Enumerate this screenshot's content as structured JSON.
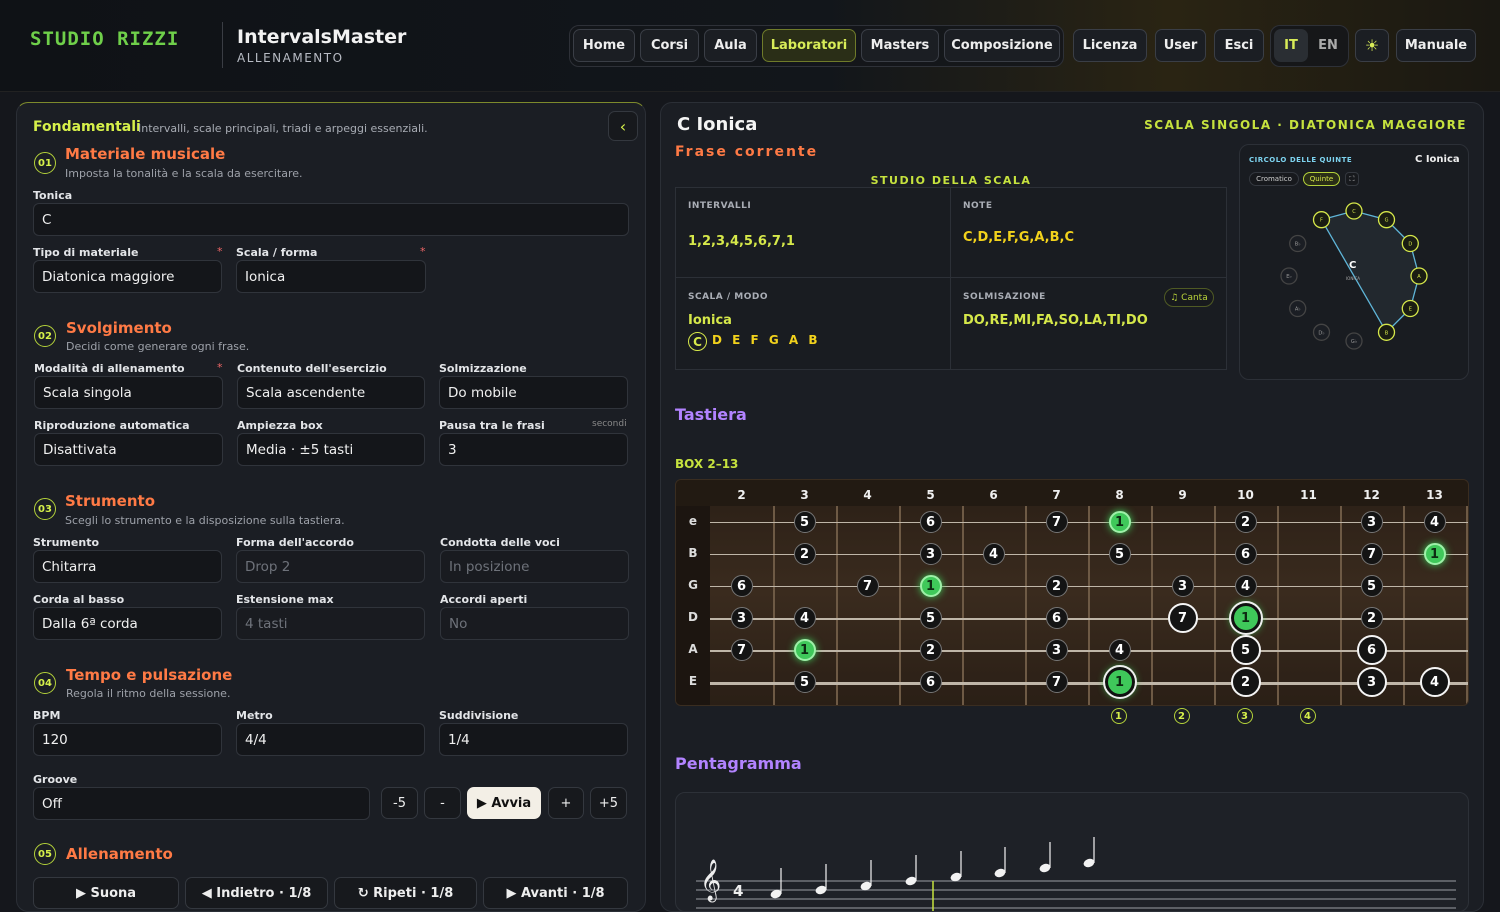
{
  "header": {
    "logo": "STUDIO RIZZI",
    "app_title": "IntervalsMaster",
    "app_subtitle": "ALLENAMENTO",
    "nav": [
      "Home",
      "Corsi",
      "Aula",
      "Laboratori",
      "Masters",
      "Composizione"
    ],
    "nav_active": "Laboratori",
    "nav2": [
      "Licenza",
      "User",
      "Esci"
    ],
    "lang": [
      "IT",
      "EN"
    ],
    "theme_icon": "sun-icon",
    "manual": "Manuale",
    "accent": "#d8ec58"
  },
  "left": {
    "title": "Fondamentali",
    "subtitle": "Intervalli, scale principali, triadi e arpeggi essenziali.",
    "collapse": "‹",
    "s1": {
      "num": "01",
      "title": "Materiale musicale",
      "sub": "Imposta la tonalità e la scala da esercitare.",
      "tonica_label": "Tonica",
      "tonica": "C",
      "tipo_label": "Tipo di materiale",
      "tipo": "Diatonica maggiore",
      "scala_label": "Scala / forma",
      "scala": "Ionica",
      "req": "*"
    },
    "s2": {
      "num": "02",
      "title": "Svolgimento",
      "sub": "Decidi come generare ogni frase.",
      "mod_label": "Modalità di allenamento",
      "mod": "Scala singola",
      "cont_label": "Contenuto dell'esercizio",
      "cont": "Scala ascendente",
      "solm_label": "Solmizzazione",
      "solm": "Do mobile",
      "rip_label": "Riproduzione automatica",
      "rip": "Disattivata",
      "amp_label": "Ampiezza box",
      "amp": "Media · ±5 tasti",
      "pausa_label": "Pausa tra le frasi",
      "pausa_unit": "secondi",
      "pausa": "3"
    },
    "s3": {
      "num": "03",
      "title": "Strumento",
      "sub": "Scegli lo strumento e la disposizione sulla tastiera.",
      "str_label": "Strumento",
      "str": "Chitarra",
      "forma_label": "Forma dell'accordo",
      "forma": "Drop 2",
      "cond_label": "Condotta delle voci",
      "cond": "In posizione",
      "corda_label": "Corda al basso",
      "corda": "Dalla 6ª corda",
      "est_label": "Estensione max",
      "est": "4 tasti",
      "acc_label": "Accordi aperti",
      "acc": "No"
    },
    "s4": {
      "num": "04",
      "title": "Tempo e pulsazione",
      "sub": "Regola il ritmo della sessione.",
      "bpm_label": "BPM",
      "bpm": "120",
      "metro_label": "Metro",
      "metro": "4/4",
      "sudd_label": "Suddivisione",
      "sudd": "1/4",
      "groove_label": "Groove",
      "groove": "Off",
      "m5": "-5",
      "minus": "-",
      "start": "▶ Avvia",
      "plus": "+",
      "p5": "+5"
    },
    "s5": {
      "num": "05",
      "title": "Allenamento",
      "play": "▶ Suona",
      "back": "◀ Indietro · 1/8",
      "repeat": "↻ Ripeti · 1/8",
      "fwd": "▶ Avanti · 1/8"
    }
  },
  "right": {
    "title": "C Ionica",
    "tag": "SCALA SINGOLA · DIATONICA MAGGIORE",
    "phrase": "Frase corrente",
    "study": "STUDIO DELLA SCALA",
    "int_cap": "INTERVALLI",
    "intervals": "1,2,3,4,5,6,7,1",
    "note_cap": "NOTE",
    "notes": "C,D,E,F,G,A,B,C",
    "mode_cap": "SCALA / MODO",
    "mode": "Ionica",
    "mode_root": "C",
    "mode_notes": "D E F G A B",
    "solm_cap": "SOLMISAZIONE",
    "solm": "DO,RE,MI,FA,SO,LA,TI,DO",
    "sing": "♫ Canta",
    "circle": {
      "title": "CIRCOLO DELLE QUINTE",
      "key": "C Ionica",
      "chrom": "Cromatico",
      "fifths": "Quinte",
      "center": "C",
      "center_sub": "IONICA",
      "notes": [
        "C",
        "G",
        "D",
        "A",
        "E",
        "B",
        "G♭",
        "D♭",
        "A♭",
        "E♭",
        "B♭",
        "F"
      ],
      "scale_notes": [
        "C",
        "G",
        "D",
        "A",
        "E",
        "B",
        "F"
      ]
    },
    "fret_title": "Tastiera",
    "box": "BOX 2–13",
    "frets": [
      "2",
      "3",
      "4",
      "5",
      "6",
      "7",
      "8",
      "9",
      "10",
      "11",
      "12",
      "13"
    ],
    "strings": [
      "e",
      "B",
      "G",
      "D",
      "A",
      "E"
    ],
    "fb_dots": [
      {
        "s": 0,
        "f": 3,
        "d": "5"
      },
      {
        "s": 0,
        "f": 5,
        "d": "6"
      },
      {
        "s": 0,
        "f": 7,
        "d": "7"
      },
      {
        "s": 0,
        "f": 8,
        "d": "1",
        "root": true
      },
      {
        "s": 0,
        "f": 10,
        "d": "2"
      },
      {
        "s": 0,
        "f": 12,
        "d": "3"
      },
      {
        "s": 0,
        "f": 13,
        "d": "4"
      },
      {
        "s": 1,
        "f": 3,
        "d": "2"
      },
      {
        "s": 1,
        "f": 5,
        "d": "3"
      },
      {
        "s": 1,
        "f": 6,
        "d": "4"
      },
      {
        "s": 1,
        "f": 8,
        "d": "5"
      },
      {
        "s": 1,
        "f": 10,
        "d": "6"
      },
      {
        "s": 1,
        "f": 12,
        "d": "7"
      },
      {
        "s": 1,
        "f": 13,
        "d": "1",
        "root": true
      },
      {
        "s": 2,
        "f": 2,
        "d": "6"
      },
      {
        "s": 2,
        "f": 4,
        "d": "7"
      },
      {
        "s": 2,
        "f": 5,
        "d": "1",
        "root": true
      },
      {
        "s": 2,
        "f": 7,
        "d": "2"
      },
      {
        "s": 2,
        "f": 9,
        "d": "3"
      },
      {
        "s": 2,
        "f": 10,
        "d": "4"
      },
      {
        "s": 2,
        "f": 12,
        "d": "5"
      },
      {
        "s": 3,
        "f": 2,
        "d": "3"
      },
      {
        "s": 3,
        "f": 3,
        "d": "4"
      },
      {
        "s": 3,
        "f": 5,
        "d": "5"
      },
      {
        "s": 3,
        "f": 7,
        "d": "6"
      },
      {
        "s": 3,
        "f": 9,
        "d": "7",
        "hl": true
      },
      {
        "s": 3,
        "f": 10,
        "d": "1",
        "root": true,
        "hl": true
      },
      {
        "s": 3,
        "f": 12,
        "d": "2"
      },
      {
        "s": 4,
        "f": 2,
        "d": "7"
      },
      {
        "s": 4,
        "f": 3,
        "d": "1",
        "root": true
      },
      {
        "s": 4,
        "f": 5,
        "d": "2"
      },
      {
        "s": 4,
        "f": 7,
        "d": "3"
      },
      {
        "s": 4,
        "f": 8,
        "d": "4"
      },
      {
        "s": 4,
        "f": 10,
        "d": "5",
        "hl": true
      },
      {
        "s": 4,
        "f": 12,
        "d": "6",
        "hl": true
      },
      {
        "s": 5,
        "f": 3,
        "d": "5"
      },
      {
        "s": 5,
        "f": 5,
        "d": "6"
      },
      {
        "s": 5,
        "f": 7,
        "d": "7"
      },
      {
        "s": 5,
        "f": 8,
        "d": "1",
        "root": true,
        "hl": true
      },
      {
        "s": 5,
        "f": 10,
        "d": "2",
        "hl": true
      },
      {
        "s": 5,
        "f": 12,
        "d": "3",
        "hl": true
      },
      {
        "s": 5,
        "f": 13,
        "d": "4",
        "hl": true
      }
    ],
    "fingers": [
      {
        "f": 8,
        "n": "1"
      },
      {
        "f": 9,
        "n": "2"
      },
      {
        "f": 10,
        "n": "3"
      },
      {
        "f": 11,
        "n": "4"
      }
    ],
    "staff_title": "Pentagramma",
    "time_sig": "4"
  }
}
